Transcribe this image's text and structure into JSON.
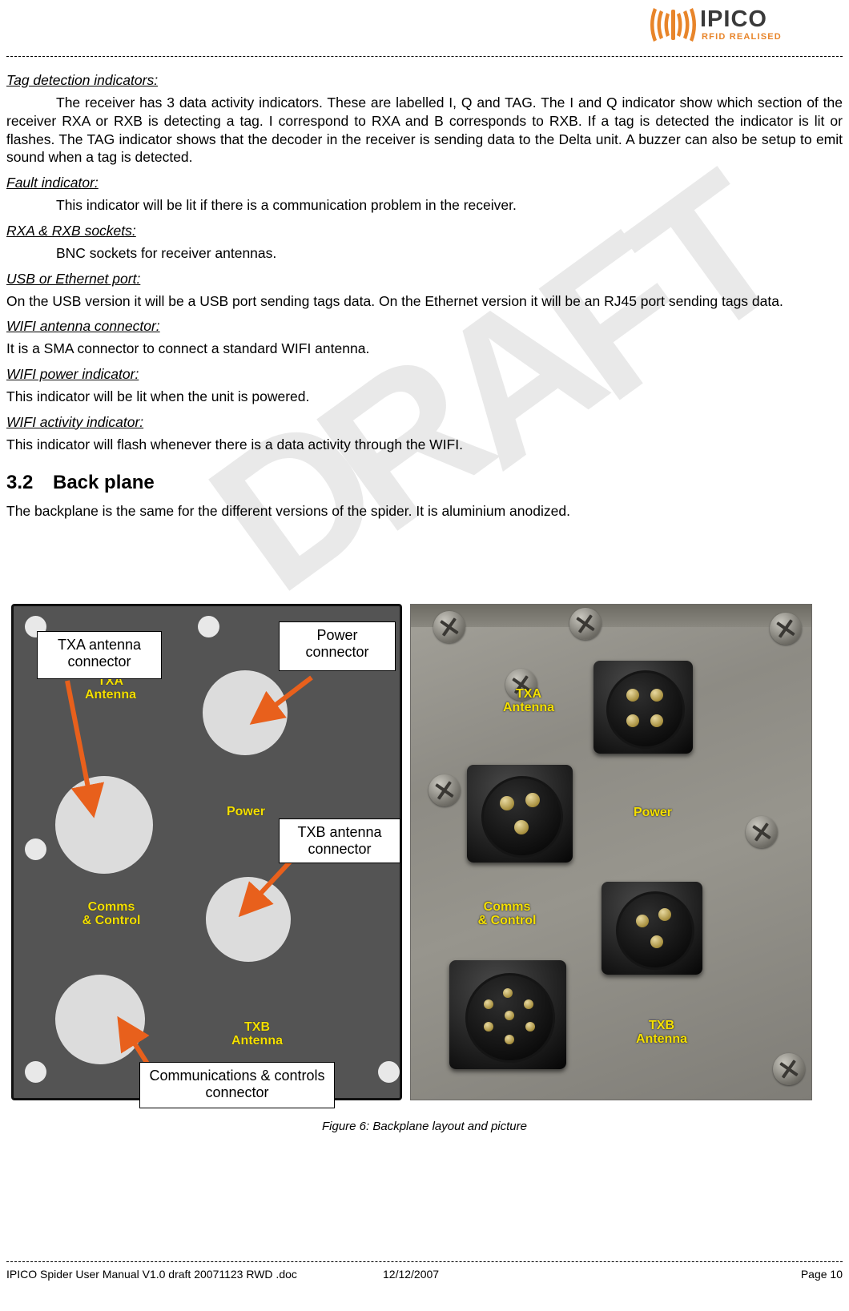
{
  "header": {
    "logo_text": "IPICO",
    "logo_sub": "RFID REALISED"
  },
  "sections": [
    {
      "heading": "Tag detection indicators:",
      "paragraph": "The receiver has 3 data activity indicators. These are labelled I, Q and TAG. The I and Q indicator show which section of the receiver RXA or RXB is detecting a tag. I correspond to RXA and B corresponds to RXB. If a tag is detected the indicator is lit or flashes. The TAG indicator shows that the decoder in the receiver is sending data to the Delta unit. A buzzer can also be setup to emit sound when a tag is detected."
    },
    {
      "heading": "Fault indicator:",
      "paragraph": "This indicator will be lit if there is a communication problem in the receiver."
    },
    {
      "heading": "RXA & RXB sockets:",
      "paragraph": "BNC sockets for receiver antennas."
    },
    {
      "heading": "USB or Ethernet port:",
      "paragraph": "On the USB version it will be a USB port sending tags data. On the Ethernet version it will be an RJ45 port sending tags data."
    },
    {
      "heading": "WIFI antenna connector:",
      "paragraph": "It is a SMA connector to connect a standard WIFI antenna."
    },
    {
      "heading": "WIFI power indicator:",
      "paragraph": "This indicator will be lit when the unit is powered."
    },
    {
      "heading": "WIFI activity indicator:",
      "paragraph": "This indicator will flash whenever there is a data activity through the WIFI."
    }
  ],
  "section_title": {
    "number": "3.2",
    "title": "Back plane",
    "paragraph": "The backplane is the same for the different versions of the spider. It is aluminium anodized."
  },
  "figure": {
    "caption": "Figure 6: Backplane layout and picture",
    "diagram_labels": {
      "txa": "TXA\nAntenna",
      "power": "Power",
      "comms": "Comms\n& Control",
      "txb": "TXB\nAntenna"
    },
    "diagram_labels_flat": {
      "txa_line1": "TXA",
      "txa_line2": "Antenna",
      "power": "Power",
      "comms_line1": "Comms",
      "comms_line2": "& Control",
      "txb_line1": "TXB",
      "txb_line2": "Antenna"
    },
    "callouts": [
      {
        "id": "txa-antenna-connector",
        "text": "TXA antenna connector"
      },
      {
        "id": "power-connector",
        "text": "Power connector"
      },
      {
        "id": "txb-antenna-connector",
        "text": "TXB antenna connector"
      },
      {
        "id": "comms-controls-connector",
        "text": "Communications & controls connector"
      }
    ],
    "photo_labels": {
      "txa_line1": "TXA",
      "txa_line2": "Antenna",
      "power": "Power",
      "comms_line1": "Comms",
      "comms_line2": "& Control",
      "txb_line1": "TXB",
      "txb_line2": "Antenna"
    },
    "label_color": "#f5e000",
    "arrow_color": "#e8601c"
  },
  "watermark": {
    "text": "DRAFT"
  },
  "footer": {
    "document": "IPICO Spider User Manual V1.0 draft 20071123 RWD .doc",
    "date": "12/12/2007",
    "page": "Page 10"
  }
}
